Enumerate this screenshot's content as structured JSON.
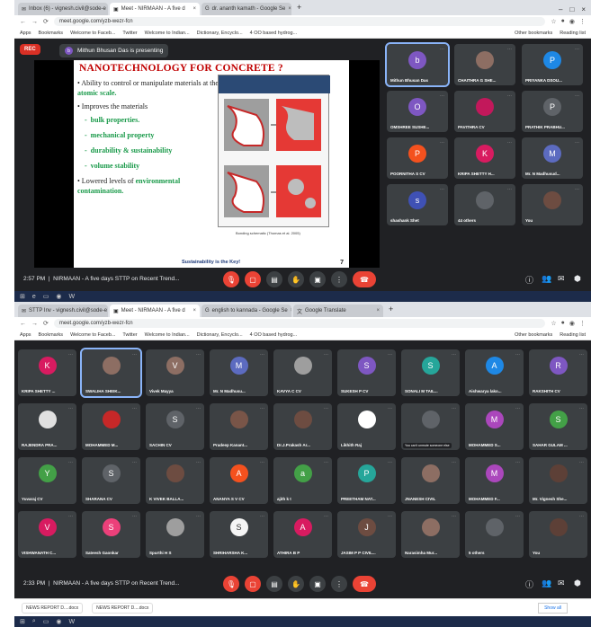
{
  "colors": {
    "meet_bg": "#202124",
    "tile_bg": "#3c4043",
    "end_call": "#ea4335",
    "slide_title": "#c00000",
    "slide_green": "#1a9a4a"
  },
  "screen1": {
    "tabs": [
      {
        "label": "Inbox (6) - vignesh.civil@sode-e",
        "active": false
      },
      {
        "label": "Meet - NIRMAAN - A five d",
        "active": true
      },
      {
        "label": "dr. ananth kamath - Google Se",
        "active": false
      }
    ],
    "url": "meet.google.com/yzb-wezr-fcn",
    "bookmarks": [
      "Apps",
      "Bookmarks",
      "Welcome to Faceb...",
      "Twitter",
      "Welcome to Indian...",
      "Dictionary, Encyclo...",
      "4 OO based hydrog..."
    ],
    "bookmarks_right": [
      "Other bookmarks",
      "Reading list"
    ],
    "rec_label": "REC",
    "presenter_initial": "b",
    "presenting_text": "Mithun Bhusan Das is presenting",
    "slide": {
      "title": "NANOTECHNOLOGY FOR CONCRETE ?",
      "b1_pre": "• Ability to control or manipulate materials at the ",
      "b1_hl": "atomic scale.",
      "b2": "• Improves the materials",
      "subs": [
        "bulk properties.",
        "mechanical property",
        "durability & sustainability",
        "volume stability"
      ],
      "b3_pre": "• Lowered levels of ",
      "b3_hl": "environmental contamination.",
      "diagram_caption": "Bonding schematic (Thomas et al. 2005)",
      "footer": "Sustainability is the Key!",
      "page": "7"
    },
    "tiles": [
      {
        "initial": "b",
        "name": "Mithun Bhusan Das",
        "color": "#7e57c2",
        "active": true
      },
      {
        "initial": "",
        "name": "CHAITHRA G SHE...",
        "color": "#8d6e63",
        "photo": true
      },
      {
        "initial": "P",
        "name": "PRIYANKA DSOU...",
        "color": "#1e88e5"
      },
      {
        "initial": "O",
        "name": "OMSHREE SUSHE...",
        "color": "#7e57c2"
      },
      {
        "initial": "",
        "name": "PAVITHRA CV",
        "color": "#c2185b",
        "photo": true
      },
      {
        "initial": "P",
        "name": "PRATHIK PRABHU...",
        "color": "#5f6368"
      },
      {
        "initial": "P",
        "name": "POORNITHA S CV",
        "color": "#f4511e"
      },
      {
        "initial": "K",
        "name": "KRIPA SHETTY H...",
        "color": "#d81b60"
      },
      {
        "initial": "M",
        "name": "Mr. N Madhusud...",
        "color": "#5c6bc0"
      },
      {
        "initial": "s",
        "name": "shashank Shet",
        "color": "#3f51b5"
      },
      {
        "initial": "",
        "name": "44 others",
        "color": "#5f6368",
        "photo": true
      },
      {
        "initial": "",
        "name": "You",
        "color": "#6d4c41",
        "photo": true
      }
    ],
    "time": "2:57 PM",
    "meeting": "NIRMAAN - A five days STTP on Recent Trend..."
  },
  "screen2": {
    "tabs": [
      {
        "label": "STTP Inv - vignesh.civil@sode-e",
        "active": false
      },
      {
        "label": "Meet - NIRMAAN - A five d",
        "active": true
      },
      {
        "label": "english to kannada - Google Se",
        "active": false
      },
      {
        "label": "Google Translate",
        "active": false
      }
    ],
    "url": "meet.google.com/yzb-wezr-fcn",
    "bookmarks": [
      "Apps",
      "Bookmarks",
      "Welcome to Faceb...",
      "Twitter",
      "Welcome to Indian...",
      "Dictionary, Encyclo...",
      "4 OO based hydrog..."
    ],
    "bookmarks_right": [
      "Other bookmarks",
      "Reading list"
    ],
    "tiles": [
      {
        "initial": "K",
        "name": "KRIPA SHETTY ...",
        "color": "#d81b60"
      },
      {
        "initial": "",
        "name": "SWALIHA SHEIK...",
        "color": "#8d6e63",
        "photo": true,
        "active": true
      },
      {
        "initial": "V",
        "name": "Vivek Mayya",
        "color": "#8d6e63"
      },
      {
        "initial": "M",
        "name": "Mr. N Madhusu...",
        "color": "#5c6bc0"
      },
      {
        "initial": "",
        "name": "KAVYA C CV",
        "color": "#9e9e9e",
        "photo": true
      },
      {
        "initial": "S",
        "name": "SUKESH P CV",
        "color": "#7e57c2"
      },
      {
        "initial": "S",
        "name": "SONALI M TAIL...",
        "color": "#26a69a"
      },
      {
        "initial": "A",
        "name": "Aishwarya lako...",
        "color": "#1e88e5"
      },
      {
        "initial": "R",
        "name": "RAKSHITH CV",
        "color": "#7e57c2"
      },
      {
        "initial": "",
        "name": "RAJENDRA PRA...",
        "color": "#e0e0e0",
        "photo": true
      },
      {
        "initial": "",
        "name": "MOHAMMED M...",
        "color": "#c62828",
        "photo": true
      },
      {
        "initial": "S",
        "name": "SACHIN CV",
        "color": "#5f6368"
      },
      {
        "initial": "",
        "name": "Pradeep Kanant...",
        "color": "#795548",
        "photo": true
      },
      {
        "initial": "",
        "name": "Dr.J.Prakash Ar...",
        "color": "#6d4c41",
        "photo": true
      },
      {
        "initial": "",
        "name": "Likhith Raj",
        "color": "#ffffff",
        "photo": true
      },
      {
        "initial": "",
        "name": "",
        "color": "#5f6368",
        "tooltip": "You can't unmute someone else"
      },
      {
        "initial": "M",
        "name": "MOHAMMED S...",
        "color": "#ab47bc"
      },
      {
        "initial": "S",
        "name": "SAHAR GULAM ...",
        "color": "#43a047"
      },
      {
        "initial": "Y",
        "name": "Yuvaraj CV",
        "color": "#43a047"
      },
      {
        "initial": "S",
        "name": "SHARANA CV",
        "color": "#5f6368"
      },
      {
        "initial": "",
        "name": "K VIVEK BALLA...",
        "color": "#6d4c41",
        "photo": true
      },
      {
        "initial": "A",
        "name": "ANANYA S V CV",
        "color": "#f4511e"
      },
      {
        "initial": "a",
        "name": "ajith k t",
        "color": "#43a047"
      },
      {
        "initial": "P",
        "name": "PREETHAM NAT...",
        "color": "#26a69a"
      },
      {
        "initial": "",
        "name": "JNANESH CIVIL",
        "color": "#8d6e63",
        "photo": true
      },
      {
        "initial": "M",
        "name": "MOHAMMED F...",
        "color": "#ab47bc"
      },
      {
        "initial": "",
        "name": "Mr. Vignesh She...",
        "color": "#5d4037",
        "photo": true
      },
      {
        "initial": "V",
        "name": "VISHWANATH C...",
        "color": "#d81b60"
      },
      {
        "initial": "S",
        "name": "Sateesh Gaonkar",
        "color": "#ec407a"
      },
      {
        "initial": "",
        "name": "Spurthi H S",
        "color": "#9e9e9e",
        "photo": true
      },
      {
        "initial": "S",
        "name": "SHRIHARSHA K...",
        "color": "#f5f5f5"
      },
      {
        "initial": "A",
        "name": "ATHIRA B P",
        "color": "#d81b60"
      },
      {
        "initial": "J",
        "name": "JASIM P P CIVIL...",
        "color": "#6d4c41"
      },
      {
        "initial": "",
        "name": "Narasimha Mur...",
        "color": "#8d6e63",
        "photo": true
      },
      {
        "initial": "",
        "name": "5 others",
        "color": "#5f6368",
        "photo": true
      },
      {
        "initial": "",
        "name": "You",
        "color": "#5d4037",
        "photo": true
      }
    ],
    "time": "2:33 PM",
    "meeting": "NIRMAAN - A five days STTP on Recent Trend...",
    "downloads": [
      "NEWS REPORT D....docx",
      "NEWS REPORT D....docx"
    ],
    "show_all": "Show all"
  }
}
